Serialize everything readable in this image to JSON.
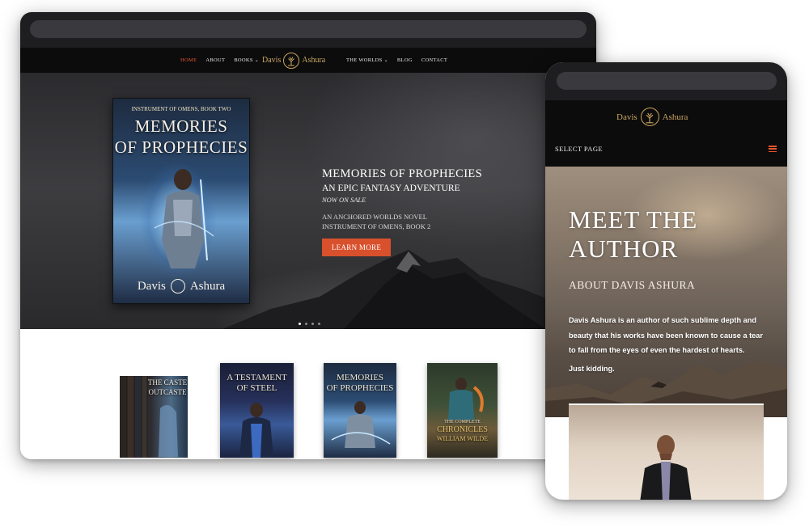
{
  "desktop": {
    "nav": {
      "left_items": [
        {
          "label": "HOME",
          "active": true
        },
        {
          "label": "ABOUT"
        },
        {
          "label": "BOOKS",
          "has_dropdown": true
        }
      ],
      "right_items": [
        {
          "label": "THE WORLDS",
          "has_dropdown": true
        },
        {
          "label": "BLOG"
        },
        {
          "label": "CONTACT"
        }
      ],
      "caret_glyph": "⌄"
    },
    "logo": {
      "first": "Davis",
      "last": "Ashura",
      "emblem_icon": "tree-emblem-icon",
      "color": "#c9a463"
    },
    "hero": {
      "book": {
        "series_line": "INSTRUMENT OF OMENS, BOOK TWO",
        "title_line_1": "MEMORIES",
        "title_line_2": "OF PROPHECIES",
        "author_first": "Davis",
        "author_last": "Ashura"
      },
      "title": "MEMORIES OF PROPHECIES",
      "subtitle": "AN EPIC FANTASY ADVENTURE",
      "tagline": "NOW ON SALE",
      "series_line_1": "AN ANCHORED WORLDS NOVEL",
      "series_line_2": "INSTRUMENT OF OMENS, BOOK 2",
      "button_label": "LEARN MORE",
      "button_color": "#d8502c",
      "slides": 4,
      "active_slide": 1
    },
    "books": [
      {
        "title_line_1": "THE CASTE",
        "title_line_2": "OUTCASTE"
      },
      {
        "title_line_1": "A TESTAMENT",
        "title_line_2": "OF STEEL"
      },
      {
        "title_line_1": "MEMORIES",
        "title_line_2": "OF PROPHECIES"
      },
      {
        "title_line_1": "THE COMPLETE",
        "title_line_2": "CHRONICLES",
        "title_line_3": "WILLIAM WILDE"
      }
    ]
  },
  "mobile": {
    "logo": {
      "first": "Davis",
      "last": "Ashura"
    },
    "select_page": "SELECT PAGE",
    "menu_icon": "hamburger-menu-icon",
    "menu_color": "#e8542e",
    "hero": {
      "title_line_1": "MEET THE",
      "title_line_2": "AUTHOR",
      "subtitle": "ABOUT DAVIS ASHURA",
      "body": "Davis Ashura is an author of such sublime depth and beauty that his works have been known to cause a tear to fall from the eyes of even the hardest of hearts.",
      "body2": "Just kidding."
    },
    "photo_icon": "author-portrait"
  },
  "colors": {
    "accent": "#e8542e",
    "nav_bg": "#0c0c0c",
    "chrome_bg": "#1e1e21",
    "gold": "#c9a463"
  }
}
